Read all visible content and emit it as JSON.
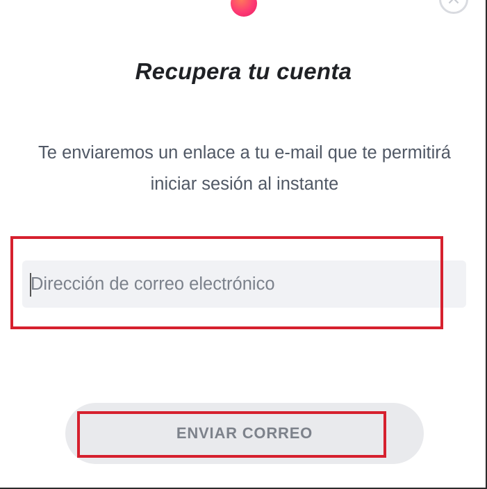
{
  "dialog": {
    "title": "Recupera tu cuenta",
    "description": "Te enviaremos un enlace a tu e-mail que te permitirá iniciar sesión al instante",
    "email_input": {
      "value": "",
      "placeholder": "Dirección de correo electrónico"
    },
    "submit_label": "ENVIAR CORREO",
    "close_icon": "close-icon",
    "logo_icon": "brand-logo-dot"
  },
  "colors": {
    "brand": "#fd3a73",
    "highlight": "#d6202e",
    "input_bg": "#f1f2f5",
    "button_bg": "#e9eaed",
    "button_text": "#7d828b",
    "title_text": "#1f2125",
    "body_text": "#505865"
  }
}
